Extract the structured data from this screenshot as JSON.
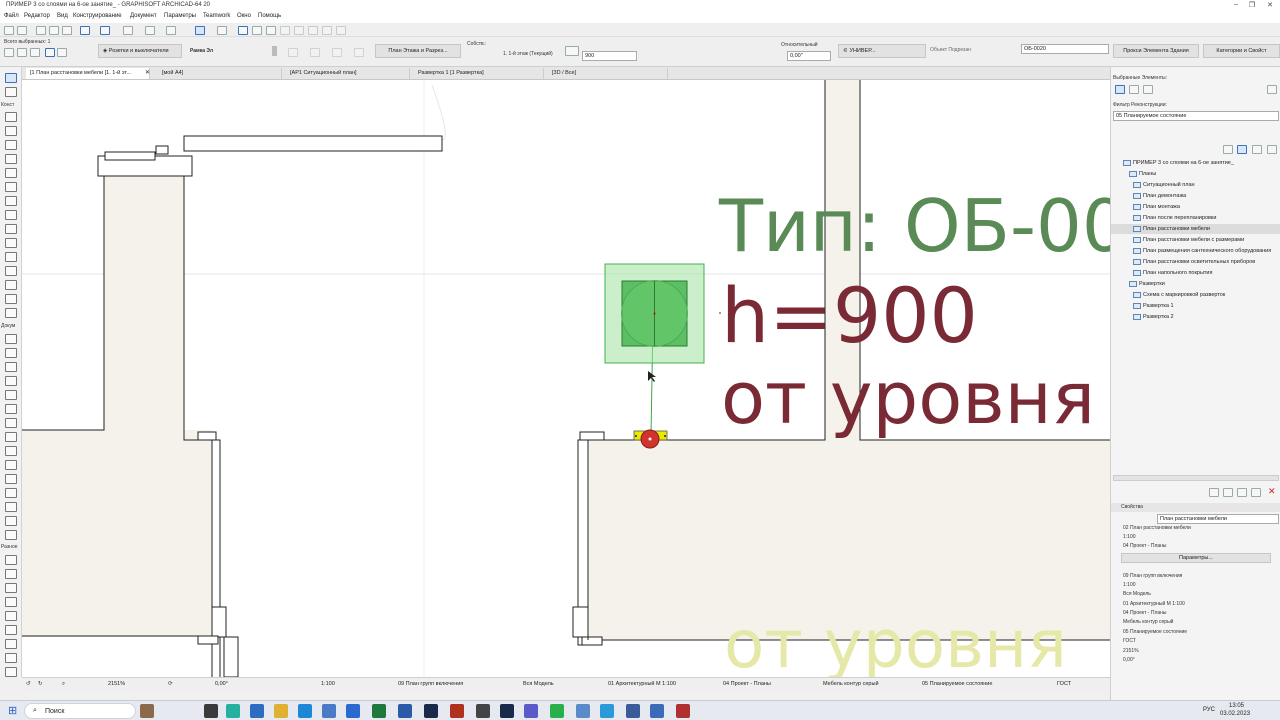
{
  "window": {
    "title": "ПРИМЕР 3 со слоями на 6-ое занятие_ - GRAPHISOFT ARCHICAD-64 20",
    "minimize": "–",
    "restore": "❐",
    "close": "✕"
  },
  "menu": [
    "Файл",
    "Редактор",
    "Вид",
    "Конструирование",
    "Документ",
    "Параметры",
    "Teamwork",
    "Окно",
    "Помощь"
  ],
  "toolbar": {
    "selected_count": "Всего выбранных: 1",
    "layer_button": "Розетки и выключатели",
    "frame_label": "Рамка Эл",
    "view_button": "План Этажа и Разрез...",
    "story_label": "Собств.:",
    "story_value": "1. 1-й этаж (Текущий)",
    "height_value": "900",
    "relative_label": "Относительный",
    "relative_value": "0,00\"",
    "univ_button": "УНИВЕР...",
    "object_label": "Объект Подрезан",
    "id_value": "ОБ-0020",
    "proxy_button": "Прокси Элемента Здания",
    "categories_button": "Категории и Свойст"
  },
  "toolbox": {
    "labels": [
      "Конст",
      "Докум",
      "Разное"
    ]
  },
  "tabs": [
    {
      "label": "[1 План расстановки мебели  [1. 1-й эт...",
      "active": true
    },
    {
      "label": "[мой А4]",
      "active": false
    },
    {
      "label": "[АР1 Ситуационный план]",
      "active": false
    },
    {
      "label": "Развертка 1 [1 Развертка]",
      "active": false
    },
    {
      "label": "[3D / Все]",
      "active": false
    }
  ],
  "canvas": {
    "label_type": "Тип: ОБ-00",
    "label_height": "h=900",
    "label_level": "от уровня",
    "label_ghost": "от уровня",
    "colors": {
      "label_type": "#5a8a55",
      "label_height": "#7a2a35",
      "label_level": "#7a2a35",
      "label_ghost": "#e6e8a8",
      "object_fill": "#5cbf63",
      "wall_fill": "#f5f2ec",
      "hotspot": "#d0342c",
      "anchor": "#e8e800"
    }
  },
  "right_panel": {
    "selected_elements": "Выбранные Элементы:",
    "filter_label": "Фильтр Реконструкции:",
    "filter_value": "05 Планируемое состояние",
    "project_root": "ПРИМЕР 3 со слоями на 6-ое занятие_",
    "plans_group": "Планы",
    "plans": [
      "Ситуационный план",
      "План демонтажа",
      "План монтажа",
      "План после перепланировки",
      "План расстановки мебели",
      "План расстановки мебели с размерами",
      "План размещения сантехнического оборудования",
      "План расстановки осветительных приборов",
      "План напольного покрытия"
    ],
    "selected_plan_index": 4,
    "elevations_group": "Развертки",
    "elevations": [
      "Схема с маркировкой разверток",
      "Развертка 1",
      "Развертка 2"
    ],
    "properties_header": "Свойства",
    "prop_name": "План расстановки мебели",
    "prop_lines": [
      "02 План расстановки мебели",
      "1:100",
      "04 Проект - Планы"
    ],
    "params_button": "Параметры...",
    "layer_list": [
      "09 План групп включения",
      "1:100",
      "Вся Модель",
      "01 Архитектурный М 1:100",
      "04 Проект - Планы",
      "Мебель контур серый",
      "05 Планируемое состояние",
      "ГОСТ",
      "2151%",
      "0,00°"
    ]
  },
  "status_bar": {
    "zoom": "2151%",
    "angle": "0,00°",
    "scale": "1:100",
    "layer_combo": "09 План групп включения",
    "model_view": "Вся Модель",
    "pen_set": "01 Архитектурный М 1:100",
    "mvo": "04 Проект - Планы",
    "override": "Мебель контур серый",
    "renovation": "05 Планируемое состояние",
    "dim": "ГОСТ"
  },
  "taskbar": {
    "search": "Поиск",
    "lang": "РУС",
    "time": "13:05",
    "date": "03.02.2023"
  }
}
